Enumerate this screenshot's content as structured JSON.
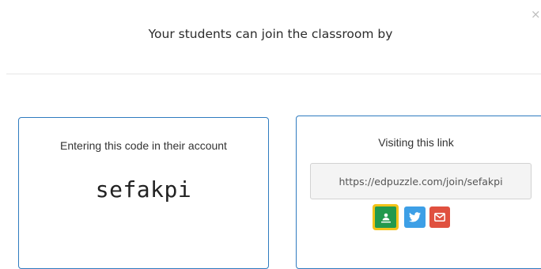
{
  "modal": {
    "title": "Your students can join the classroom by",
    "close_glyph": "×"
  },
  "code_card": {
    "label": "Entering this code in their account",
    "code": "sefakpi"
  },
  "link_card": {
    "label": "Visiting this link",
    "url": "https://edpuzzle.com/join/sefakpi"
  },
  "share_buttons": [
    {
      "icon": "google-classroom-icon",
      "color": "#22994d",
      "border": "#f2c318"
    },
    {
      "icon": "twitter-icon",
      "color": "#3d9fe6"
    },
    {
      "icon": "email-icon",
      "color": "#e0503f"
    }
  ]
}
